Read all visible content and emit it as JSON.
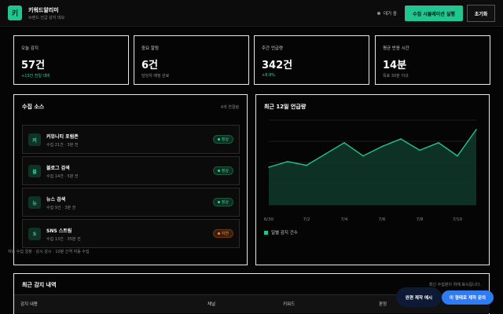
{
  "header": {
    "logo_text": "키",
    "title": "키워드알리미",
    "subtitle": "브랜드 언급 감지 데모",
    "status": "대기 중",
    "sim_button": "수집 시뮬레이션 실행",
    "reset_button": "초기화"
  },
  "stats": [
    {
      "label": "오늘 감지",
      "value": "57건",
      "sub": "+13건 전일 대비",
      "sub_color": "green"
    },
    {
      "label": "중요 알림",
      "value": "6건",
      "sub": "담당자 배정 완료",
      "sub_color": "gray"
    },
    {
      "label": "주간 언급량",
      "value": "342건",
      "sub": "+8.9%",
      "sub_color": "green"
    },
    {
      "label": "평균 반응 시간",
      "value": "14분",
      "sub": "목표 30분 이내",
      "sub_color": "gray"
    }
  ],
  "sources": {
    "title": "수집 소스",
    "meta": "4개 연결됨",
    "items": [
      {
        "icon": "커",
        "name": "커뮤니티 포럼존",
        "meta": "수집 21건 · 3분 전",
        "status": "정상",
        "state": "ok"
      },
      {
        "icon": "블",
        "name": "블로그 검색",
        "meta": "수집 14건 · 5분 전",
        "status": "정상",
        "state": "ok"
      },
      {
        "icon": "뉴",
        "name": "뉴스 검색",
        "meta": "수집 9건 · 3분 전",
        "status": "정상",
        "state": "ok"
      },
      {
        "icon": "S",
        "name": "SNS 스트림",
        "meta": "수집 13건 · 35분 전",
        "status": "지연",
        "state": "delay"
      }
    ],
    "footer": "자동 수집 일정 · 상시 감시 · 10분 간격 자동 수집"
  },
  "trend": {
    "title": "최근 12일 언급량",
    "legend": "일별 감지 건수"
  },
  "chart_data": {
    "type": "area",
    "title": "최근 12일 언급량",
    "x": [
      "6/30",
      "7/1",
      "7/2",
      "7/3",
      "7/4",
      "7/5",
      "7/6",
      "7/7",
      "7/8",
      "7/9",
      "7/10",
      "7/11"
    ],
    "tick_labels": [
      "6/30",
      "7/2",
      "7/4",
      "7/6",
      "7/8",
      "7/10"
    ],
    "series": [
      {
        "name": "일별 감지 건수",
        "values": [
          40,
          43,
          41,
          47,
          53,
          46,
          51,
          55,
          49,
          53,
          46,
          60
        ],
        "color": "#20c58f"
      }
    ],
    "ylim": [
      20,
      65
    ],
    "grid": true,
    "legend_position": "bottom-left"
  },
  "history": {
    "title": "최근 감지 내역",
    "meta": "최신 수집분이 위에 표시됩니다.",
    "columns": [
      "감지 내용",
      "채널",
      "키워드",
      "판정"
    ]
  },
  "fab": {
    "demo": "완편 제작 예시",
    "custom": "이 형태로 제작 문의"
  }
}
